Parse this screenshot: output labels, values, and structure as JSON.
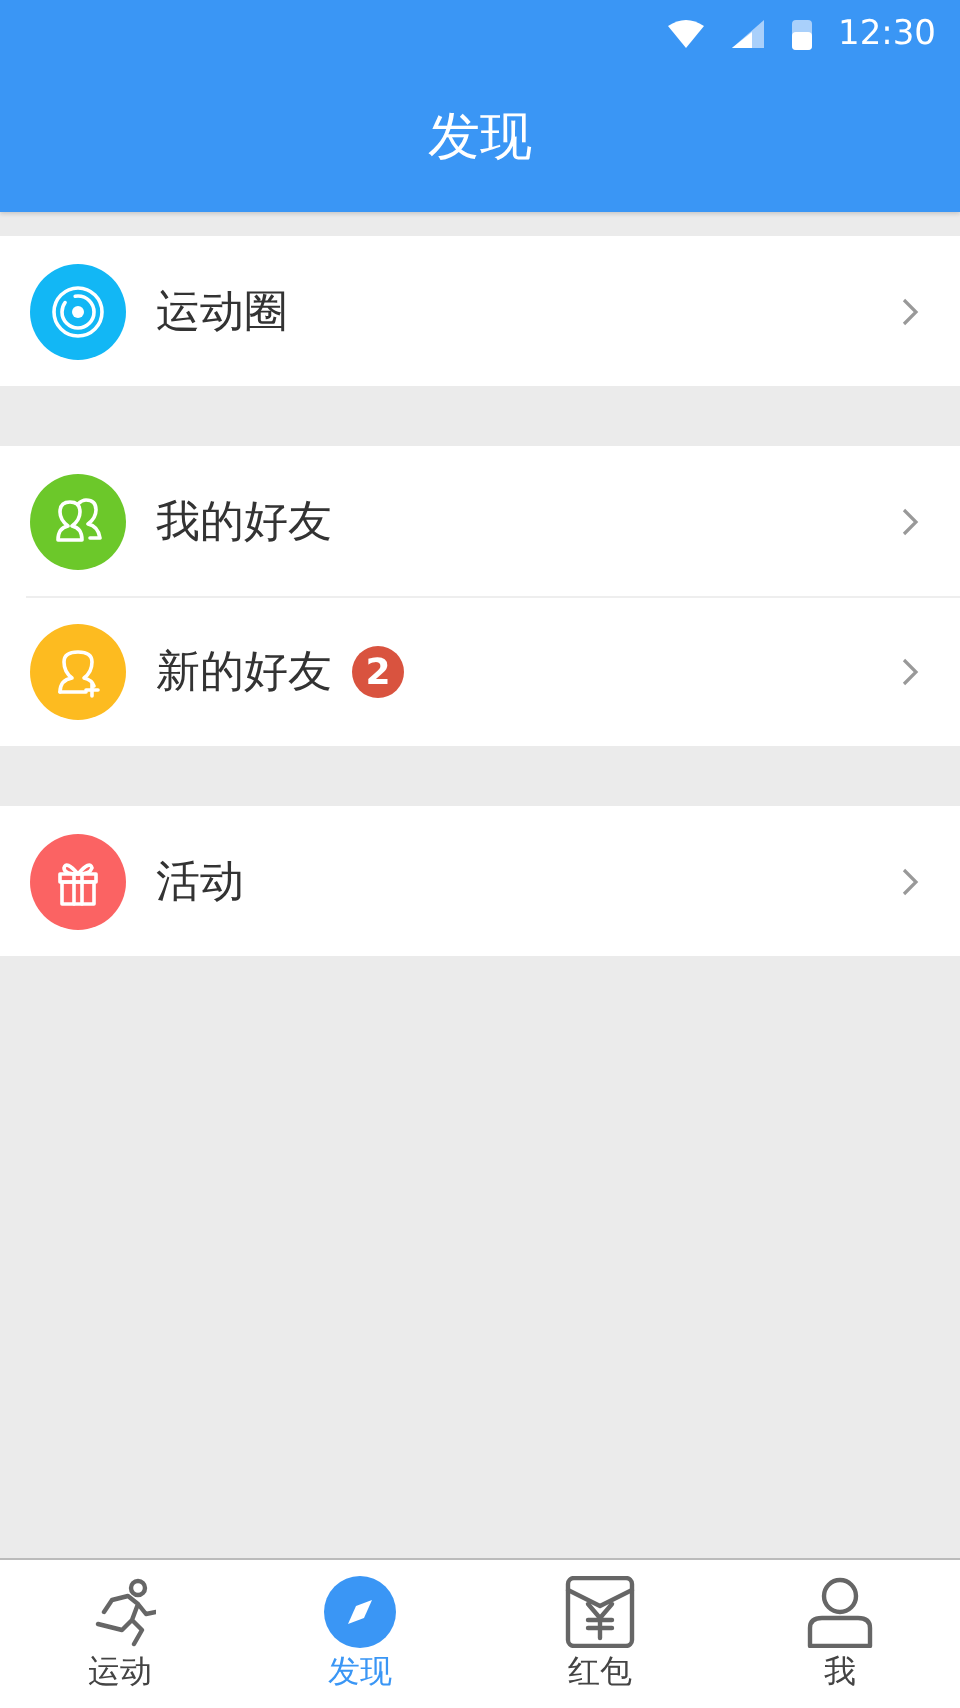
{
  "status_bar": {
    "time": "12:30"
  },
  "header": {
    "title": "发现"
  },
  "groups": [
    {
      "items": [
        {
          "label": "运动圈",
          "color": "#12b7f5"
        }
      ]
    },
    {
      "items": [
        {
          "label": "我的好友",
          "color": "#6cc82a"
        },
        {
          "label": "新的好友",
          "color": "#fdbb20",
          "badge": "2"
        }
      ]
    },
    {
      "items": [
        {
          "label": "活动",
          "color": "#fb6363"
        }
      ]
    }
  ],
  "tabs": [
    {
      "label": "运动",
      "selected": false
    },
    {
      "label": "发现",
      "selected": true
    },
    {
      "label": "红包",
      "selected": false
    },
    {
      "label": "我",
      "selected": false
    }
  ]
}
